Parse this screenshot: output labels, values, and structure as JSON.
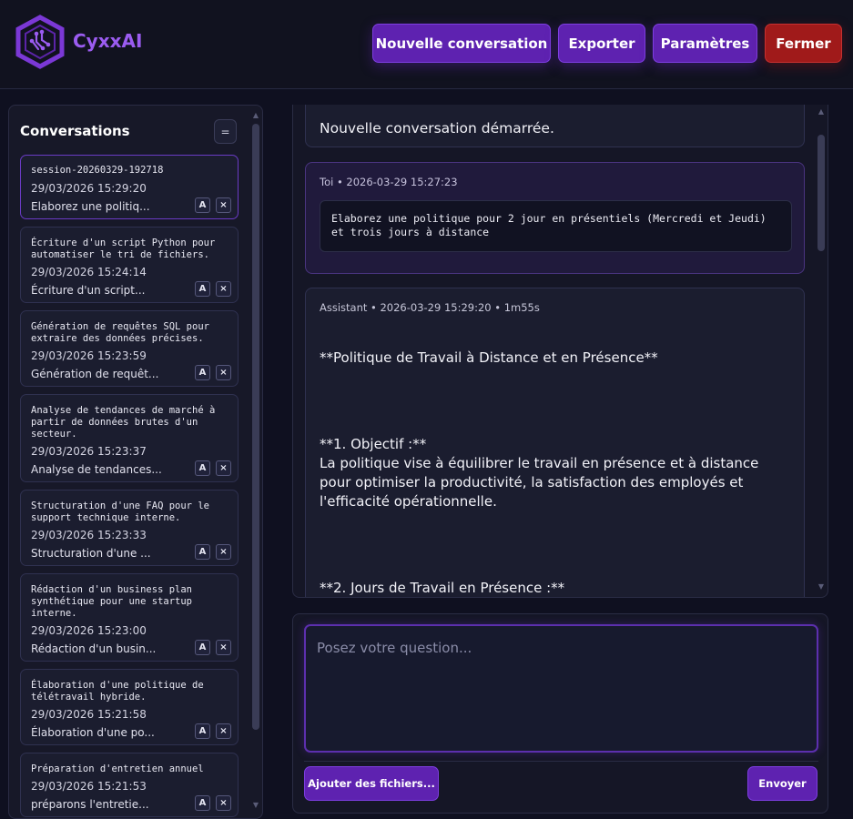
{
  "app": {
    "title": "CyxxAI",
    "logo_icon": "circuit-hexagon-logo",
    "accent": "#6a2bc2",
    "danger": "#a01a1a"
  },
  "header": {
    "new_label": "Nouvelle conversation",
    "export_label": "Exporter",
    "settings_label": "Paramètres",
    "close_label": "Fermer"
  },
  "sidebar": {
    "title": "Conversations",
    "toggle_icon": "=",
    "item_buttons": {
      "rename": "A",
      "delete": "×"
    },
    "items": [
      {
        "title": "session-20260329-192718",
        "date": "29/03/2026 15:29:20",
        "preview": "Elaborez une politiq..."
      },
      {
        "title": "Écriture d'un script Python pour automatiser le tri de fichiers.",
        "date": "29/03/2026 15:24:14",
        "preview": "Écriture d'un script..."
      },
      {
        "title": "Génération de requêtes SQL pour extraire des données précises.",
        "date": "29/03/2026 15:23:59",
        "preview": "Génération de requêt..."
      },
      {
        "title": "Analyse de tendances de marché à partir de données brutes d'un secteur.",
        "date": "29/03/2026 15:23:37",
        "preview": "Analyse de tendances..."
      },
      {
        "title": "Structuration d'une FAQ pour le support technique interne.",
        "date": "29/03/2026 15:23:33",
        "preview": "Structuration d'une ..."
      },
      {
        "title": "Rédaction d'un business plan synthétique pour une startup interne.",
        "date": "29/03/2026 15:23:00",
        "preview": "Rédaction d'un busin..."
      },
      {
        "title": "Élaboration d'une politique de télétravail hybride.",
        "date": "29/03/2026 15:21:58",
        "preview": "Élaboration d'une po..."
      },
      {
        "title": "Préparation d'entretien annuel",
        "date": "29/03/2026 15:21:53",
        "preview": "préparons l'entretie..."
      }
    ]
  },
  "chat": {
    "system_message": "Nouvelle conversation démarrée.",
    "user_message": {
      "meta": "Toi • 2026-03-29 15:27:23",
      "text": "Elaborez une politique pour 2 jour en présentiels (Mercredi et Jeudi) et trois jours à distance"
    },
    "assistant_message": {
      "meta": "Assistant • 2026-03-29 15:29:20 • 1m55s",
      "heading": "**Politique de Travail à Distance et en Présence**",
      "section1_title": "**1. Objectif :**",
      "section1_body": "La politique vise à équilibrer le travail en présence et à distance pour optimiser la productivité, la satisfaction des employés et l'efficacité opérationnelle.",
      "section2_title": "**2. Jours de Travail en Présence :**"
    }
  },
  "composer": {
    "placeholder": "Posez votre question...",
    "files_label": "Ajouter des fichiers...",
    "send_label": "Envoyer"
  }
}
